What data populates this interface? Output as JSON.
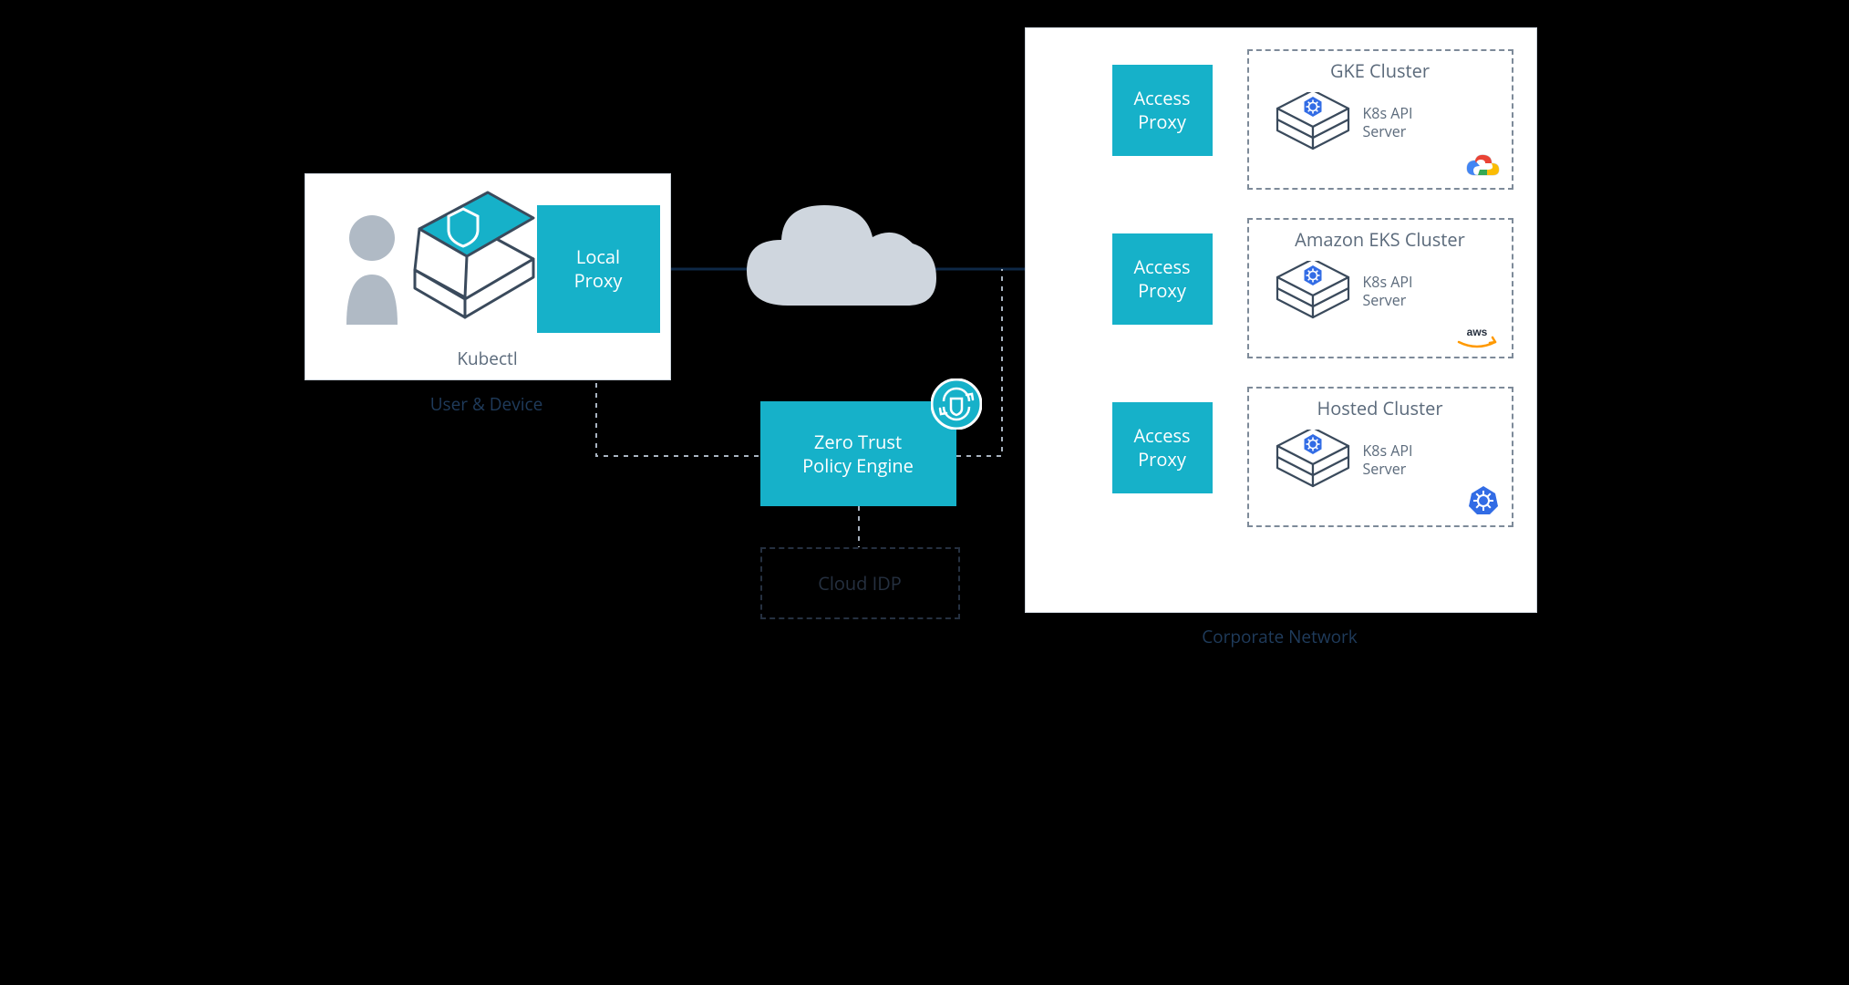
{
  "user_panel": {
    "kubectl_label": "Kubectl",
    "local_proxy_label": "Local\nProxy",
    "caption": "User & Device"
  },
  "center": {
    "policy_engine_label": "Zero Trust\nPolicy Engine",
    "cloud_idp_label": "Cloud IDP"
  },
  "corporate": {
    "caption": "Corporate Network",
    "access_proxy_label": "Access\nProxy",
    "clusters": [
      {
        "title": "GKE Cluster",
        "api_label": "K8s API\nServer",
        "provider": "gcp"
      },
      {
        "title": "Amazon EKS Cluster",
        "api_label": "K8s API\nServer",
        "provider": "aws"
      },
      {
        "title": "Hosted Cluster",
        "api_label": "K8s API\nServer",
        "provider": "k8s"
      }
    ]
  },
  "colors": {
    "teal": "#16b1c9",
    "line": "#0e2846",
    "cloud": "#cfd6de"
  }
}
